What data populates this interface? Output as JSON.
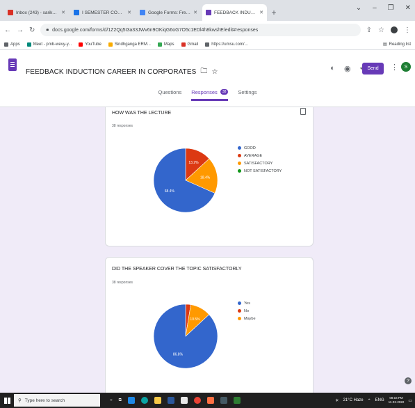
{
  "browser": {
    "tabs": [
      {
        "title": "Inbox (243) - sarikokumar1406@...",
        "color": "#d93025"
      },
      {
        "title": "I SEMESTER COMMON CLASS 2...",
        "color": "#1a73e8"
      },
      {
        "title": "Google Forms: Free Online Form...",
        "color": "#4285f4"
      },
      {
        "title": "FEEDBACK INDUCTION CAREER...",
        "color": "#673ab7"
      }
    ],
    "url": "docs.google.com/forms/d/1Z2Qq5t3a33JWv6n9OKiqG6oG7O5c1EDl4h8kwshE/edit#responses",
    "window_controls": [
      "⌄",
      "–",
      "❐",
      "✕"
    ],
    "bookmarks": [
      {
        "label": "Apps",
        "color": "#5f6368"
      },
      {
        "label": "Meet - pmb-wevy-y...",
        "color": "#00897b"
      },
      {
        "label": "YouTube",
        "color": "#ff0000"
      },
      {
        "label": "Sindhganga ERM...",
        "color": "#f9ab00"
      },
      {
        "label": "Maps",
        "color": "#34a853"
      },
      {
        "label": "Gmail",
        "color": "#d93025"
      },
      {
        "label": "https://umsu.com/...",
        "color": "#5f6368"
      }
    ],
    "reading_list": "Reading list"
  },
  "form": {
    "title": "FEEDBACK INDUCTION CAREER IN CORPORATES",
    "send_label": "Send",
    "avatar_letter": "S",
    "tabs": {
      "questions": "Questions",
      "responses": "Responses",
      "responses_count": "38",
      "settings": "Settings"
    }
  },
  "questions": [
    {
      "title": "HOW WAS THE LECTURE",
      "responses": "38 responses",
      "chart_data": {
        "type": "pie",
        "categories": [
          "GOOD",
          "AVERAGE",
          "SATISFACTORY",
          "NOT SATISFACTORY"
        ],
        "values": [
          68.4,
          13.2,
          18.4,
          0
        ],
        "colors": [
          "#3366cc",
          "#dc3912",
          "#ff9900",
          "#109618"
        ],
        "data_labels": [
          "68.4%",
          "13.2%",
          "18.4%",
          ""
        ]
      }
    },
    {
      "title": "DID THE SPEAKER COVER THE TOPIC SATISFACTORLY",
      "responses": "38 responses",
      "chart_data": {
        "type": "pie",
        "categories": [
          "Yes",
          "No",
          "Maybe"
        ],
        "values": [
          86.8,
          2.6,
          10.5
        ],
        "colors": [
          "#3366cc",
          "#dc3912",
          "#ff9900"
        ],
        "data_labels": [
          "86.8%",
          "",
          "10.5%"
        ]
      }
    }
  ],
  "taskbar": {
    "search_placeholder": "Type here to search",
    "weather": "21°C Haze",
    "lang": "ENG",
    "time": "08:16 PM",
    "date": "11-02-2022"
  },
  "help": "?"
}
